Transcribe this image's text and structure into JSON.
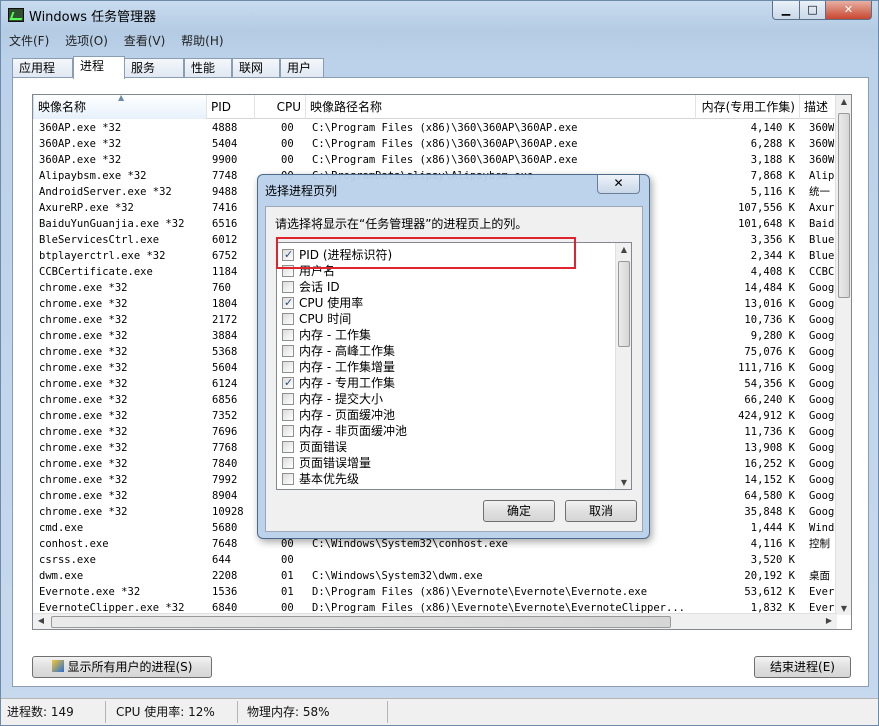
{
  "window": {
    "title": "Windows 任务管理器",
    "min": "▁",
    "max": "□",
    "close": "✕"
  },
  "menu": [
    "文件(F)",
    "选项(O)",
    "查看(V)",
    "帮助(H)"
  ],
  "tabs": [
    "应用程序",
    "进程",
    "服务",
    "性能",
    "联网",
    "用户"
  ],
  "active_tab": "进程",
  "columns": {
    "name": "映像名称",
    "pid": "PID",
    "cpu": "CPU",
    "path": "映像路径名称",
    "mem": "内存(专用工作集)",
    "desc": "描述"
  },
  "rows": [
    {
      "name": "360AP.exe *32",
      "pid": "4888",
      "cpu": "00",
      "path": "C:\\Program Files (x86)\\360\\360AP\\360AP.exe",
      "mem": "4,140 K",
      "desc": "360W"
    },
    {
      "name": "360AP.exe *32",
      "pid": "5404",
      "cpu": "00",
      "path": "C:\\Program Files (x86)\\360\\360AP\\360AP.exe",
      "mem": "6,288 K",
      "desc": "360W"
    },
    {
      "name": "360AP.exe *32",
      "pid": "9900",
      "cpu": "00",
      "path": "C:\\Program Files (x86)\\360\\360AP\\360AP.exe",
      "mem": "3,188 K",
      "desc": "360W"
    },
    {
      "name": "Alipaybsm.exe *32",
      "pid": "7748",
      "cpu": "00",
      "path": "C:\\ProgramData\\alipay\\Alipaybsm.exe",
      "mem": "7,868 K",
      "desc": "Alip"
    },
    {
      "name": "AndroidServer.exe *32",
      "pid": "9488",
      "cpu": "",
      "path": "",
      "mem": "5,116 K",
      "desc": "统一"
    },
    {
      "name": "AxureRP.exe *32",
      "pid": "7416",
      "cpu": "",
      "path": "",
      "mem": "107,556 K",
      "desc": "Axur"
    },
    {
      "name": "BaiduYunGuanjia.exe *32",
      "pid": "6516",
      "cpu": "",
      "path": "",
      "mem": "101,648 K",
      "desc": "Baid"
    },
    {
      "name": "BleServicesCtrl.exe",
      "pid": "6012",
      "cpu": "",
      "path": "e",
      "mem": "3,356 K",
      "desc": "Blue"
    },
    {
      "name": "btplayerctrl.exe *32",
      "pid": "6752",
      "cpu": "",
      "path": "",
      "mem": "2,344 K",
      "desc": "Blue"
    },
    {
      "name": "CCBCertificate.exe",
      "pid": "1184",
      "cpu": "",
      "path": "",
      "mem": "4,408 K",
      "desc": "CCBC"
    },
    {
      "name": "chrome.exe *32",
      "pid": "760",
      "cpu": "",
      "path": "...",
      "mem": "14,484 K",
      "desc": "Goog"
    },
    {
      "name": "chrome.exe *32",
      "pid": "1804",
      "cpu": "",
      "path": "...",
      "mem": "13,016 K",
      "desc": "Goog"
    },
    {
      "name": "chrome.exe *32",
      "pid": "2172",
      "cpu": "",
      "path": "...",
      "mem": "10,736 K",
      "desc": "Goog"
    },
    {
      "name": "chrome.exe *32",
      "pid": "3884",
      "cpu": "",
      "path": "...",
      "mem": "9,280 K",
      "desc": "Goog"
    },
    {
      "name": "chrome.exe *32",
      "pid": "5368",
      "cpu": "",
      "path": "...",
      "mem": "75,076 K",
      "desc": "Goog"
    },
    {
      "name": "chrome.exe *32",
      "pid": "5604",
      "cpu": "",
      "path": "...",
      "mem": "111,716 K",
      "desc": "Goog"
    },
    {
      "name": "chrome.exe *32",
      "pid": "6124",
      "cpu": "",
      "path": "...",
      "mem": "54,356 K",
      "desc": "Goog"
    },
    {
      "name": "chrome.exe *32",
      "pid": "6856",
      "cpu": "",
      "path": "...",
      "mem": "66,240 K",
      "desc": "Goog"
    },
    {
      "name": "chrome.exe *32",
      "pid": "7352",
      "cpu": "",
      "path": "...",
      "mem": "424,912 K",
      "desc": "Goog"
    },
    {
      "name": "chrome.exe *32",
      "pid": "7696",
      "cpu": "",
      "path": "...",
      "mem": "11,736 K",
      "desc": "Goog"
    },
    {
      "name": "chrome.exe *32",
      "pid": "7768",
      "cpu": "",
      "path": "...",
      "mem": "13,908 K",
      "desc": "Goog"
    },
    {
      "name": "chrome.exe *32",
      "pid": "7840",
      "cpu": "",
      "path": "...",
      "mem": "16,252 K",
      "desc": "Goog"
    },
    {
      "name": "chrome.exe *32",
      "pid": "7992",
      "cpu": "",
      "path": "...",
      "mem": "14,152 K",
      "desc": "Goog"
    },
    {
      "name": "chrome.exe *32",
      "pid": "8904",
      "cpu": "",
      "path": "...",
      "mem": "64,580 K",
      "desc": "Goog"
    },
    {
      "name": "chrome.exe *32",
      "pid": "10928",
      "cpu": "",
      "path": "...",
      "mem": "35,848 K",
      "desc": "Goog"
    },
    {
      "name": "cmd.exe",
      "pid": "5680",
      "cpu": "",
      "path": "",
      "mem": "1,444 K",
      "desc": "Wind"
    },
    {
      "name": "conhost.exe",
      "pid": "7648",
      "cpu": "00",
      "path": "C:\\Windows\\System32\\conhost.exe",
      "mem": "4,116 K",
      "desc": "控制"
    },
    {
      "name": "csrss.exe",
      "pid": "644",
      "cpu": "00",
      "path": "",
      "mem": "3,520 K",
      "desc": ""
    },
    {
      "name": "dwm.exe",
      "pid": "2208",
      "cpu": "01",
      "path": "C:\\Windows\\System32\\dwm.exe",
      "mem": "20,192 K",
      "desc": "桌面"
    },
    {
      "name": "Evernote.exe *32",
      "pid": "1536",
      "cpu": "01",
      "path": "D:\\Program Files (x86)\\Evernote\\Evernote\\Evernote.exe",
      "mem": "53,612 K",
      "desc": "Ever"
    },
    {
      "name": "EvernoteClipper.exe *32",
      "pid": "6840",
      "cpu": "00",
      "path": "D:\\Program Files (x86)\\Evernote\\Evernote\\EvernoteClipper...",
      "mem": "1,832 K",
      "desc": "Ever"
    },
    {
      "name": "EvernoteTray.exe *32",
      "pid": "7380",
      "cpu": "00",
      "path": "D:\\Program Files (x86)\\Evernote\\Evernote\\EvernoteTray.exe",
      "mem": "1,340 K",
      "desc": "Ever"
    }
  ],
  "buttons": {
    "show_all": "显示所有用户的进程(S)",
    "end_process": "结束进程(E)"
  },
  "status": {
    "processes": "进程数: 149",
    "cpu": "CPU 使用率: 12%",
    "memory": "物理内存: 58%"
  },
  "dialog": {
    "title": "选择进程页列",
    "close": "✕",
    "prompt": "请选择将显示在“任务管理器”的进程页上的列。",
    "items": [
      {
        "label": "PID (进程标识符)",
        "checked": true
      },
      {
        "label": "用户名",
        "checked": false
      },
      {
        "label": "会话 ID",
        "checked": false
      },
      {
        "label": "CPU 使用率",
        "checked": true
      },
      {
        "label": "CPU 时间",
        "checked": false
      },
      {
        "label": "内存 - 工作集",
        "checked": false
      },
      {
        "label": "内存 - 高峰工作集",
        "checked": false
      },
      {
        "label": "内存 - 工作集增量",
        "checked": false
      },
      {
        "label": "内存 - 专用工作集",
        "checked": true
      },
      {
        "label": "内存 - 提交大小",
        "checked": false
      },
      {
        "label": "内存 - 页面缓冲池",
        "checked": false
      },
      {
        "label": "内存 - 非页面缓冲池",
        "checked": false
      },
      {
        "label": "页面错误",
        "checked": false
      },
      {
        "label": "页面错误增量",
        "checked": false
      },
      {
        "label": "基本优先级",
        "checked": false
      }
    ],
    "ok": "确定",
    "cancel": "取消"
  },
  "colors": {
    "highlight_box": "#e0242e"
  }
}
